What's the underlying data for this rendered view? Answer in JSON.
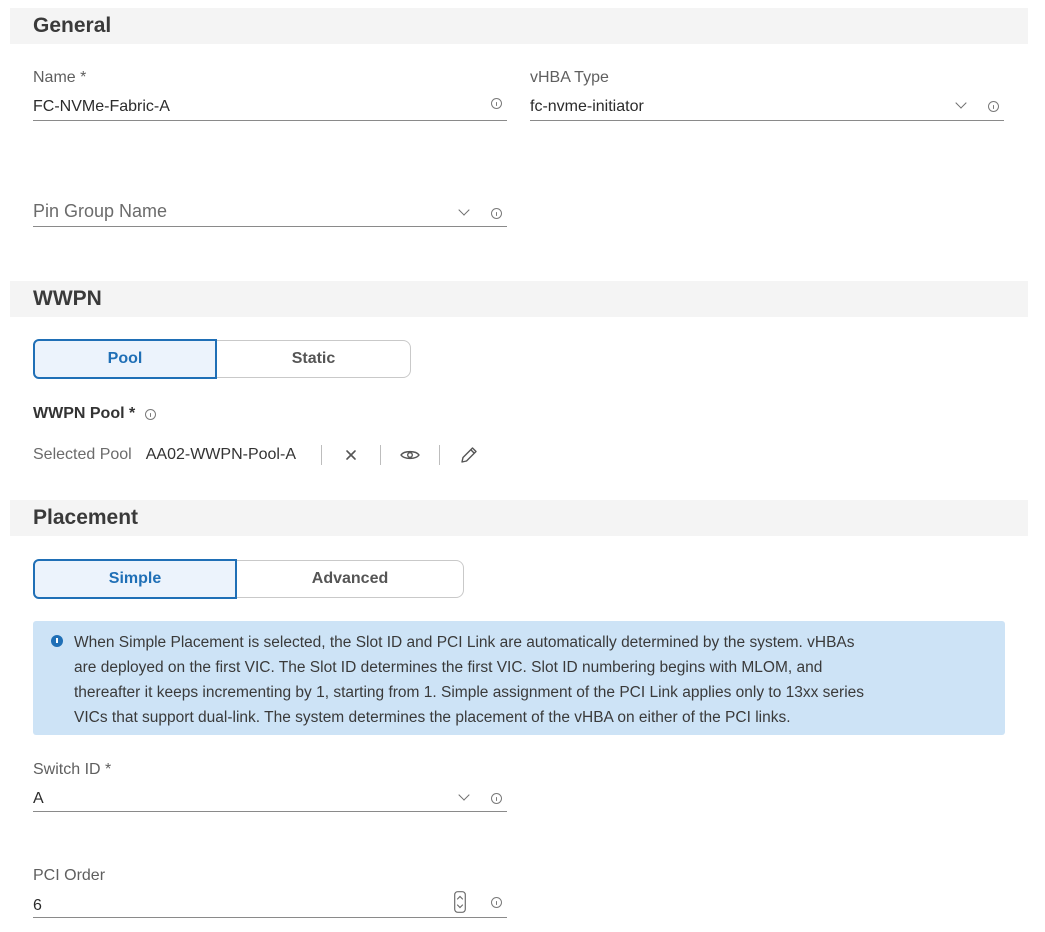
{
  "general": {
    "title": "General",
    "name": {
      "label": "Name *",
      "value": "FC-NVMe-Fabric-A"
    },
    "vhba_type": {
      "label": "vHBA Type",
      "value": "fc-nvme-initiator"
    },
    "pin_group": {
      "placeholder": "Pin Group Name"
    }
  },
  "wwpn": {
    "title": "WWPN",
    "toggle": {
      "options": [
        "Pool",
        "Static"
      ],
      "selected": "Pool"
    },
    "pool_label": "WWPN Pool *",
    "selected_pool_label": "Selected Pool",
    "selected_pool_value": "AA02-WWPN-Pool-A"
  },
  "placement": {
    "title": "Placement",
    "toggle": {
      "options": [
        "Simple",
        "Advanced"
      ],
      "selected": "Simple"
    },
    "notice_lines": [
      "When Simple Placement is selected, the Slot ID and PCI Link are automatically determined by the system. vHBAs",
      "are deployed on the first VIC. The Slot ID determines the first VIC. Slot ID numbering begins with MLOM, and",
      "thereafter it keeps incrementing by 1, starting from 1. Simple assignment of the PCI Link applies only to 13xx series",
      "VICs that support dual-link. The system determines the placement of the vHBA on either of the PCI links."
    ],
    "switch_id": {
      "label": "Switch ID *",
      "value": "A"
    },
    "pci_order": {
      "label": "PCI Order",
      "value": "6"
    }
  },
  "colors": {
    "accent": "#1f6fb6",
    "notice_bg": "#cde3f6",
    "header_bg": "#f4f4f4"
  }
}
